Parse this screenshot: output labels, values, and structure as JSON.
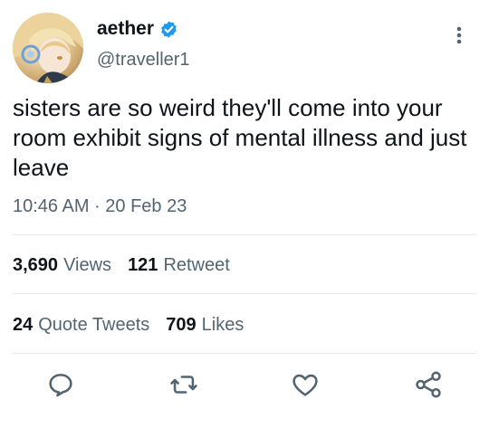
{
  "tweet": {
    "display_name": "aether",
    "handle": "@traveller1",
    "text": "sisters are so weird they'll come into your room exhibit signs of mental illness and just leave",
    "timestamp": "10:46 AM · 20 Feb 23"
  },
  "stats": {
    "views_count": "3,690",
    "views_label": "Views",
    "retweets_count": "121",
    "retweets_label": "Retweet",
    "quotes_count": "24",
    "quotes_label": "Quote Tweets",
    "likes_count": "709",
    "likes_label": "Likes"
  },
  "icons": {
    "verified": "verified-badge-icon",
    "more": "more-vertical-icon",
    "reply": "reply-icon",
    "retweet": "retweet-icon",
    "like": "heart-icon",
    "share": "share-icon"
  },
  "colors": {
    "verified": "#1d9bf0",
    "text": "#0f1419",
    "muted": "#536471",
    "divider": "#e6e9eb"
  }
}
